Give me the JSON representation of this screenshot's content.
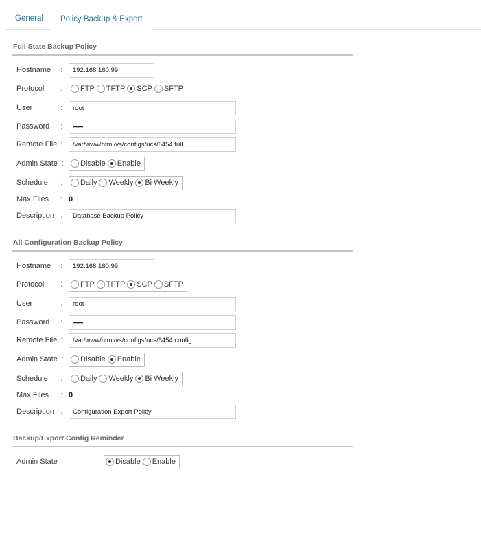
{
  "tabs": [
    {
      "label": "General",
      "active": false
    },
    {
      "label": "Policy Backup & Export",
      "active": true
    }
  ],
  "colon": ":",
  "full_state": {
    "title": "Full State Backup Policy",
    "hostname_label": "Hostname",
    "hostname": "192.168.160.99",
    "protocol_label": "Protocol",
    "protocol_options": [
      "FTP",
      "TFTP",
      "SCP",
      "SFTP"
    ],
    "protocol_selected": "SCP",
    "user_label": "User",
    "user": "root",
    "password_label": "Password",
    "password": "••••••••",
    "remote_file_label": "Remote File",
    "remote_file": "/var/www/html/vs/configs/ucs/6454.full",
    "admin_state_label": "Admin State",
    "admin_state_options": [
      "Disable",
      "Enable"
    ],
    "admin_state_selected": "Enable",
    "schedule_label": "Schedule",
    "schedule_options": [
      "Daily",
      "Weekly",
      "Bi Weekly"
    ],
    "schedule_selected": "Bi Weekly",
    "max_files_label": "Max Files",
    "max_files": "0",
    "description_label": "Description",
    "description": "Database Backup Policy"
  },
  "all_config": {
    "title": "All Configuration Backup Policy",
    "hostname_label": "Hostname",
    "hostname": "192.168.160.99",
    "protocol_label": "Protocol",
    "protocol_options": [
      "FTP",
      "TFTP",
      "SCP",
      "SFTP"
    ],
    "protocol_selected": "SCP",
    "user_label": "User",
    "user": "root",
    "password_label": "Password",
    "password": "••••••••",
    "remote_file_label": "Remote File",
    "remote_file": "/var/www/html/vs/configs/ucs/6454.config",
    "admin_state_label": "Admin State",
    "admin_state_options": [
      "Disable",
      "Enable"
    ],
    "admin_state_selected": "Enable",
    "schedule_label": "Schedule",
    "schedule_options": [
      "Daily",
      "Weekly",
      "Bi Weekly"
    ],
    "schedule_selected": "Bi Weekly",
    "max_files_label": "Max Files",
    "max_files": "0",
    "description_label": "Description",
    "description": "Configuration Export Policy"
  },
  "reminder": {
    "title": "Backup/Export Config Reminder",
    "admin_state_label": "Admin State",
    "admin_state_options": [
      "Disable",
      "Enable"
    ],
    "admin_state_selected": "Disable"
  }
}
